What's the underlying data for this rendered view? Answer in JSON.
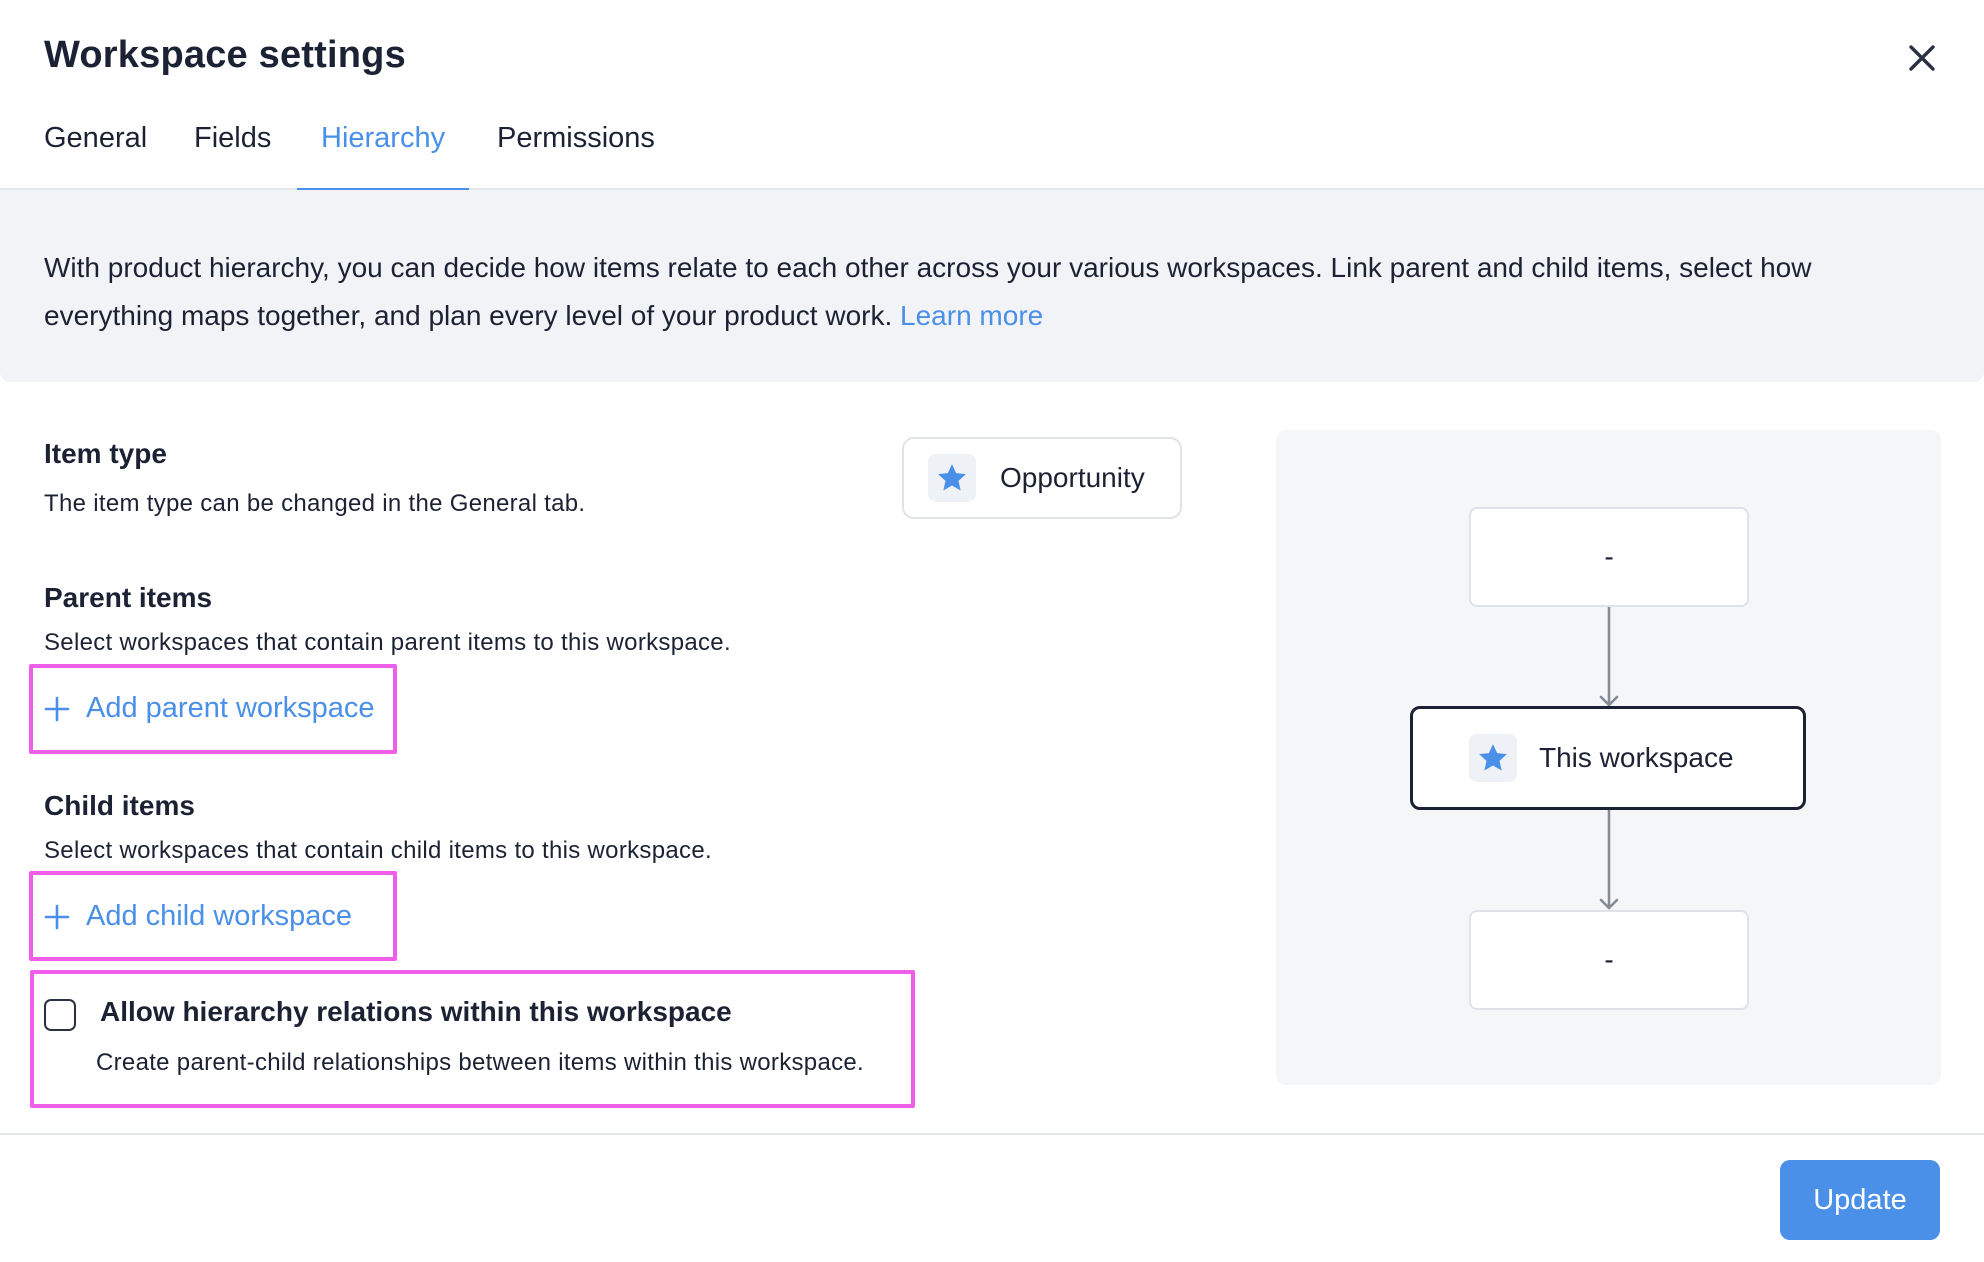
{
  "dialog": {
    "title": "Workspace settings"
  },
  "tabs": [
    {
      "label": "General",
      "active": false
    },
    {
      "label": "Fields",
      "active": false
    },
    {
      "label": "Hierarchy",
      "active": true
    },
    {
      "label": "Permissions",
      "active": false
    }
  ],
  "banner": {
    "text": "With product hierarchy, you can decide how items relate to each other across your various workspaces. Link parent and child items, select how everything maps together, and plan every level of your product work.",
    "link": "Learn more"
  },
  "item_type": {
    "title": "Item type",
    "description": "The item type can be changed in the General tab.",
    "value": "Opportunity",
    "icon": "star-icon"
  },
  "parent_items": {
    "title": "Parent items",
    "description": "Select workspaces that contain parent items to this workspace.",
    "add_label": "Add parent workspace"
  },
  "child_items": {
    "title": "Child items",
    "description": "Select workspaces that contain child items to this workspace.",
    "add_label": "Add child workspace"
  },
  "allow_within": {
    "label": "Allow hierarchy relations within this workspace",
    "description": "Create parent-child relationships between items within this workspace.",
    "checked": false
  },
  "diagram": {
    "parent_node": "-",
    "current_node": "This workspace",
    "child_node": "-"
  },
  "footer": {
    "update_label": "Update"
  },
  "colors": {
    "accent": "#4a8fe8",
    "highlight": "#ee5ee8",
    "text": "#1b2233",
    "banner_bg": "#f1f3f6"
  }
}
